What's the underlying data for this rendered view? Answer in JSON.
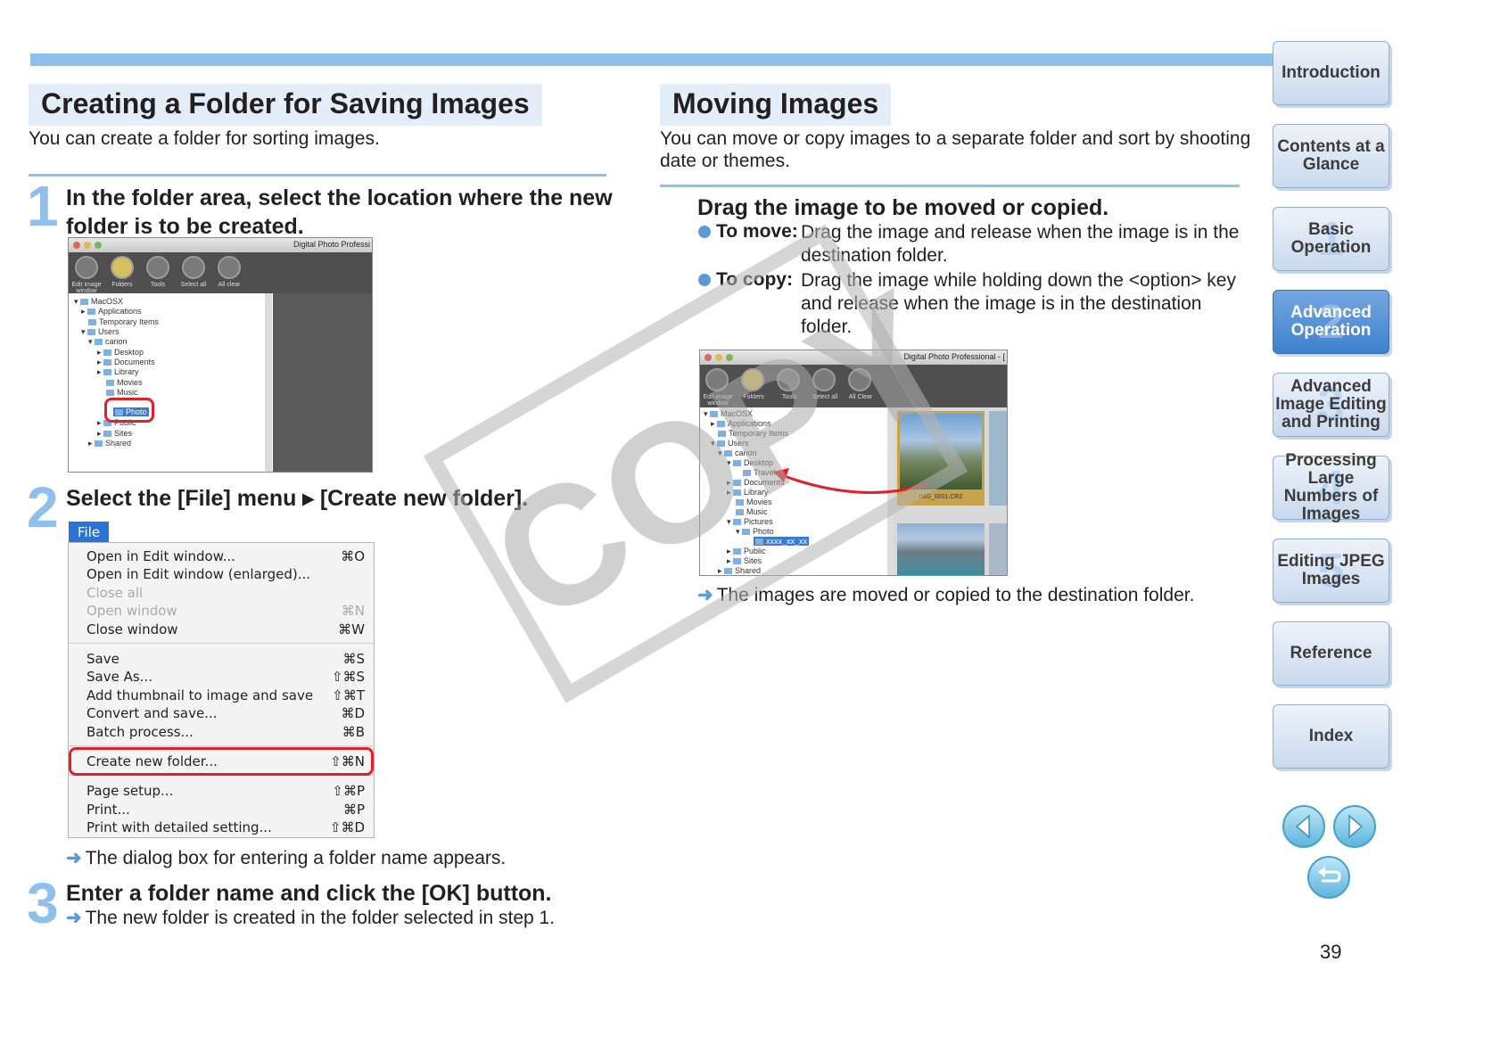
{
  "left": {
    "title": "Creating a Folder for Saving Images",
    "intro": "You can create a folder for sorting images.",
    "step1": {
      "num": "1",
      "text1": "In the folder area, select the location where the new",
      "text2": "folder is to be created."
    },
    "step2": {
      "num": "2",
      "text": "Select the [File] menu ▸ [Create new folder]."
    },
    "step2_note": "The dialog box for entering a folder name appears.",
    "step3": {
      "num": "3",
      "text": "Enter a folder name and click the [OK] button.",
      "note": "The new folder is created in the folder selected in step 1."
    }
  },
  "shot1": {
    "window_title": "Digital Photo Professi",
    "toolbar": [
      "Edit image window",
      "Folders",
      "Tools",
      "Select all",
      "All clear"
    ],
    "tree": [
      "MacOSX",
      "Applications",
      "Temporary Items",
      "Users",
      "canon",
      "Desktop",
      "Documents",
      "Library",
      "Movies",
      "Music",
      "Photo",
      "Public",
      "Sites",
      "Shared"
    ]
  },
  "menu": {
    "tab": "File",
    "items": [
      {
        "label": "Open in Edit window...",
        "shortcut": "⌘O",
        "disabled": false
      },
      {
        "label": "Open in Edit window (enlarged)...",
        "shortcut": "",
        "disabled": false
      },
      {
        "label": "Close all",
        "shortcut": "",
        "disabled": true
      },
      {
        "label": "Open window",
        "shortcut": "⌘N",
        "disabled": true
      },
      {
        "label": "Close window",
        "shortcut": "⌘W",
        "disabled": false
      },
      {
        "label": "Save",
        "shortcut": "⌘S",
        "disabled": false
      },
      {
        "label": "Save As...",
        "shortcut": "⇧⌘S",
        "disabled": false
      },
      {
        "label": "Add thumbnail to image and save",
        "shortcut": "⇧⌘T",
        "disabled": false
      },
      {
        "label": "Convert and save...",
        "shortcut": "⌘D",
        "disabled": false
      },
      {
        "label": "Batch process...",
        "shortcut": "⌘B",
        "disabled": false
      },
      {
        "label": "Create new folder...",
        "shortcut": "⇧⌘N",
        "disabled": false
      },
      {
        "label": "Page setup...",
        "shortcut": "⇧⌘P",
        "disabled": false
      },
      {
        "label": "Print...",
        "shortcut": "⌘P",
        "disabled": false
      },
      {
        "label": "Print with detailed setting...",
        "shortcut": "⇧⌘D",
        "disabled": false
      }
    ]
  },
  "right": {
    "title": "Moving Images",
    "intro1": "You can move or copy images to a separate folder and sort by shooting",
    "intro2": "date or themes.",
    "heading": "Drag the image to be moved or copied.",
    "move_label": "To move:",
    "move_text1": "Drag the image and release when the image is in the",
    "move_text2": "destination folder.",
    "copy_label": "To copy:",
    "copy_text1": "Drag the image while holding down the <option> key",
    "copy_text2": "and release when the image is in the destination",
    "copy_text3": "folder.",
    "result": "The images are moved or copied to the destination folder."
  },
  "shot2": {
    "window_title": "Digital Photo Professional - [",
    "toolbar": [
      "Edit image window",
      "Folders",
      "Tools",
      "Select all",
      "All Clear"
    ],
    "tree": [
      "MacOSX",
      "Applications",
      "Temporary Items",
      "Users",
      "canon",
      "Desktop",
      "Travel",
      "Documents",
      "Library",
      "Movies",
      "Music",
      "Pictures",
      "Photo",
      "xxxx_xx_xx",
      "Public",
      "Sites",
      "Shared"
    ],
    "thumb_caption": "IMG_0001.CR2"
  },
  "watermark": "COPY",
  "nav": [
    {
      "label": "Introduction",
      "num": "",
      "active": false
    },
    {
      "label": "Contents at a Glance",
      "num": "",
      "active": false
    },
    {
      "label": "Basic Operation",
      "num": "1",
      "active": false
    },
    {
      "label": "Advanced Operation",
      "num": "2",
      "active": true
    },
    {
      "label": "Advanced Image Editing and Printing",
      "num": "3",
      "active": false
    },
    {
      "label": "Processing Large Numbers of Images",
      "num": "4",
      "active": false
    },
    {
      "label": "Editing JPEG Images",
      "num": "5",
      "active": false
    },
    {
      "label": "Reference",
      "num": "",
      "active": false
    },
    {
      "label": "Index",
      "num": "",
      "active": false
    }
  ],
  "page_number": "39",
  "colors": {
    "accent": "#8fbfed",
    "highlight": "#e0202a",
    "nav_active": "#3f80cc"
  }
}
